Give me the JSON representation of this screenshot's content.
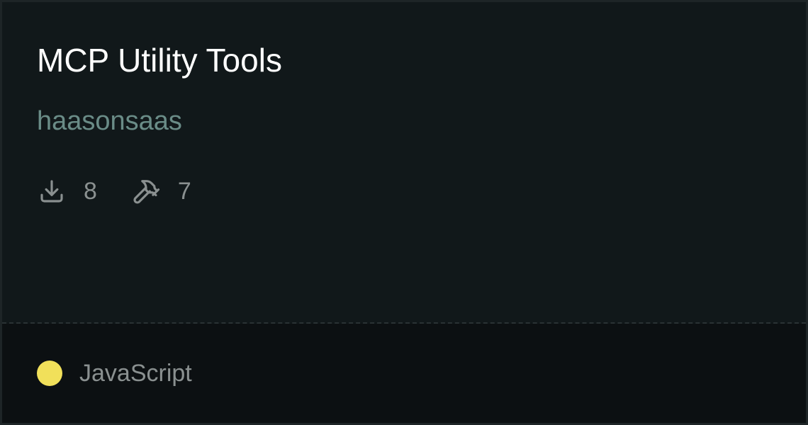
{
  "card": {
    "title": "MCP Utility Tools",
    "author": "haasonsaas",
    "stats": {
      "downloads": {
        "icon": "download-icon",
        "value": "8"
      },
      "tools": {
        "icon": "hammer-icon",
        "value": "7"
      }
    },
    "language": {
      "name": "JavaScript",
      "color": "#f1e05a"
    }
  }
}
